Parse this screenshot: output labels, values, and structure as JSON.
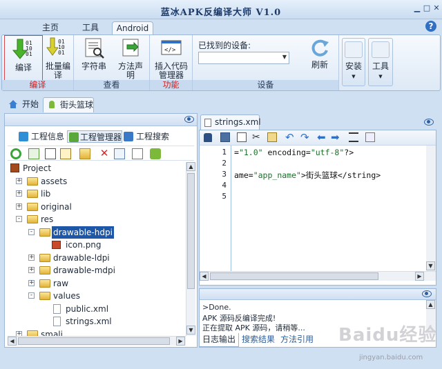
{
  "window": {
    "title": "蓝冰APK反编译大师 V1.0"
  },
  "ribbon_tabs": [
    "主页",
    "工具",
    "Android"
  ],
  "ribbon": {
    "groups": [
      {
        "caption": "编译",
        "buttons": [
          "编译",
          "批量编译"
        ]
      },
      {
        "caption": "查看",
        "buttons": [
          "字符串",
          "方法声明"
        ]
      },
      {
        "caption": "功能",
        "buttons": [
          "插入代码管理器"
        ]
      },
      {
        "caption": "设备",
        "device_label": "已找到的设备:",
        "device_value": "",
        "buttons": [
          "刷新"
        ]
      }
    ],
    "extra_buttons": [
      "安装",
      "工具"
    ]
  },
  "doc_tabs": [
    "开始",
    "街头篮球"
  ],
  "left_panel": {
    "tabs": [
      "工程信息",
      "工程管理器",
      "工程搜索"
    ],
    "tree": [
      {
        "label": "Project",
        "level": 0,
        "type": "project"
      },
      {
        "label": "assets",
        "level": 1,
        "type": "folder",
        "expander": "+"
      },
      {
        "label": "lib",
        "level": 1,
        "type": "folder",
        "expander": "+"
      },
      {
        "label": "original",
        "level": 1,
        "type": "folder",
        "expander": "+"
      },
      {
        "label": "res",
        "level": 1,
        "type": "folder",
        "expander": "-"
      },
      {
        "label": "drawable-hdpi",
        "level": 2,
        "type": "folder",
        "expander": "-",
        "selected": true
      },
      {
        "label": "icon.png",
        "level": 3,
        "type": "image"
      },
      {
        "label": "drawable-ldpi",
        "level": 2,
        "type": "folder",
        "expander": "+"
      },
      {
        "label": "drawable-mdpi",
        "level": 2,
        "type": "folder",
        "expander": "+"
      },
      {
        "label": "raw",
        "level": 2,
        "type": "folder",
        "expander": "+"
      },
      {
        "label": "values",
        "level": 2,
        "type": "folder",
        "expander": "-"
      },
      {
        "label": "public.xml",
        "level": 3,
        "type": "file"
      },
      {
        "label": "strings.xml",
        "level": 3,
        "type": "file"
      },
      {
        "label": "smali",
        "level": 1,
        "type": "folder",
        "expander": "+"
      }
    ]
  },
  "editor": {
    "tab": "strings.xml",
    "lines": [
      {
        "num": "1",
        "pre": "=",
        "str": "\"1.0\"",
        "mid": " encoding=",
        "str2": "\"utf-8\"",
        "post": "?>"
      },
      {
        "num": "2",
        "pre": "",
        "str": "",
        "mid": "",
        "str2": "",
        "post": ""
      },
      {
        "num": "3",
        "pre": "ame=",
        "str": "\"app_name\"",
        "mid": ">街头篮球</string>",
        "str2": "",
        "post": ""
      },
      {
        "num": "4",
        "pre": "",
        "str": "",
        "mid": "",
        "str2": "",
        "post": ""
      },
      {
        "num": "5",
        "pre": "",
        "str": "",
        "mid": "",
        "str2": "",
        "post": ""
      }
    ]
  },
  "output": {
    "lines": [
      ">Done.",
      "APK 源码反编译完成!",
      "正在提取 APK 源码，请稍等..."
    ],
    "tabs": [
      "日志输出",
      "搜索结果",
      "方法引用"
    ]
  },
  "watermark": {
    "brand": "Baidu经验",
    "url": "jingyan.baidu.com"
  },
  "colors": {
    "accent": "#1e56a8",
    "ribbon_bg": "#dde9f6",
    "group_caption_red": "#c0262b"
  }
}
